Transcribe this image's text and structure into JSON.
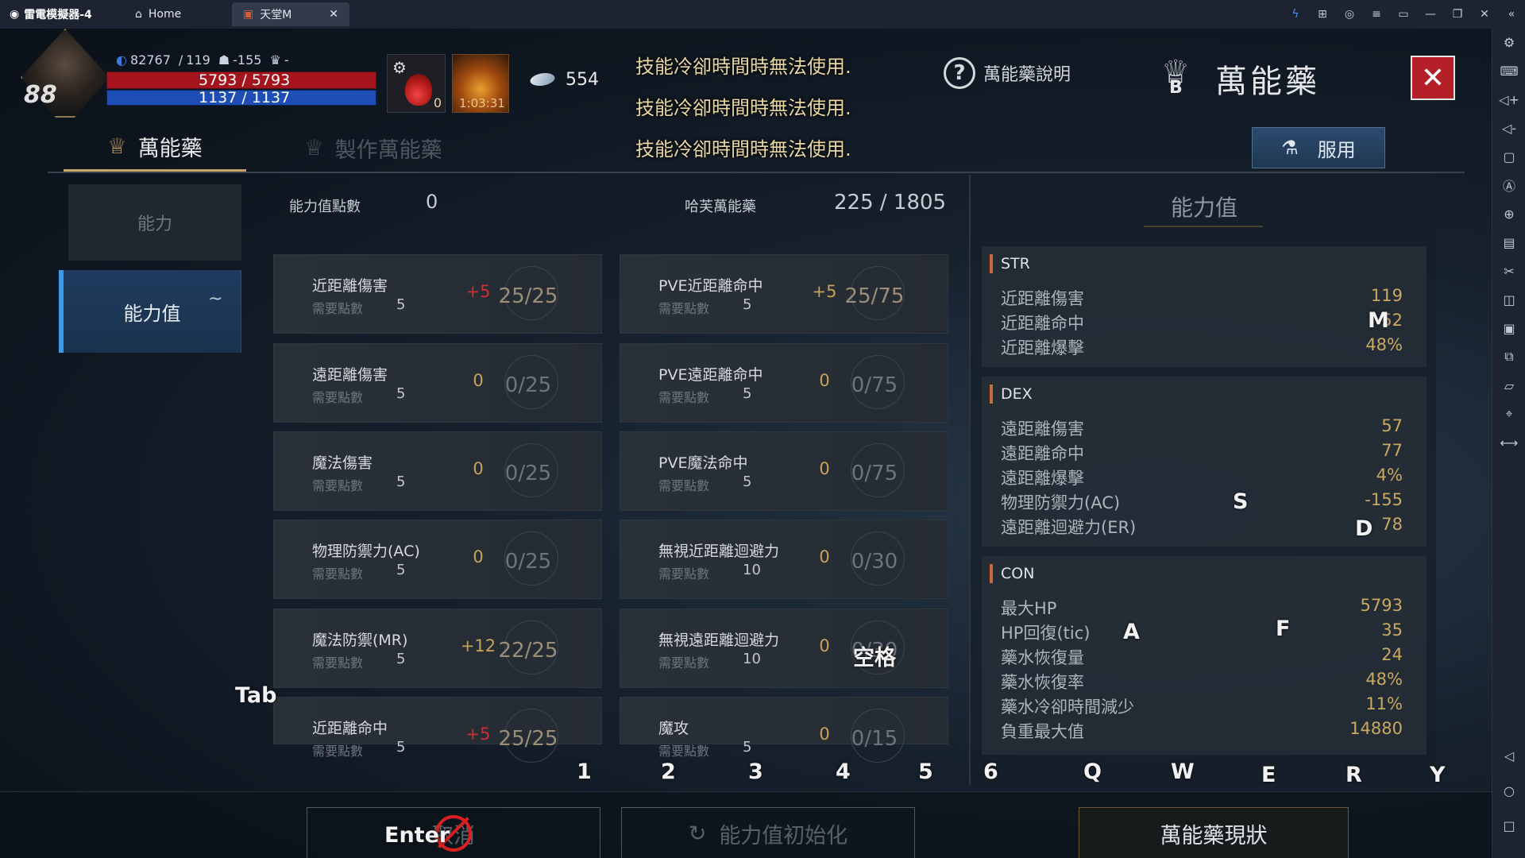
{
  "emulator": {
    "app_title": "雷電模擬器-4",
    "tabs": [
      {
        "label": "Home"
      },
      {
        "label": "天堂M"
      }
    ]
  },
  "hud": {
    "level": "88",
    "stat_a": "82767",
    "stat_b": "119",
    "stat_c": "-155",
    "stat_d": "-",
    "hp": "5793 / 5793",
    "mp": "1137 / 1137",
    "potion_count": "0",
    "buff_count": "1:03:31",
    "currency": "554",
    "cooldown_messages": [
      "技能冷卻時間時無法使用.",
      "技能冷卻時間時無法使用.",
      "技能冷卻時間時無法使用."
    ],
    "help_label": "萬能藥說明",
    "title": "萬能藥",
    "title_badge": "B"
  },
  "tabs": {
    "potion": "萬能藥",
    "craft": "製作萬能藥",
    "use_button": "服用"
  },
  "nav": {
    "ability": "能力",
    "stats": "能力值",
    "stats_badge": "~"
  },
  "counts": {
    "points_label": "能力值點數",
    "points_value": "0",
    "potion_label": "哈芙萬能藥",
    "potion_value": "225 / 1805"
  },
  "cost_label": "需要點數",
  "cards": [
    {
      "name": "近距離傷害",
      "bonus": "+5",
      "progress": "25/25",
      "cost": "5",
      "style": "red",
      "full": true
    },
    {
      "name": "PVE近距離命中",
      "bonus": "+5",
      "progress": "25/75",
      "cost": "5",
      "style": "gold",
      "full": true
    },
    {
      "name": "遠距離傷害",
      "bonus": "0",
      "progress": "0/25",
      "cost": "5",
      "style": "grey",
      "full": false
    },
    {
      "name": "PVE遠距離命中",
      "bonus": "0",
      "progress": "0/75",
      "cost": "5",
      "style": "grey",
      "full": false
    },
    {
      "name": "魔法傷害",
      "bonus": "0",
      "progress": "0/25",
      "cost": "5",
      "style": "grey",
      "full": false
    },
    {
      "name": "PVE魔法命中",
      "bonus": "0",
      "progress": "0/75",
      "cost": "5",
      "style": "grey",
      "full": false
    },
    {
      "name": "物理防禦力(AC)",
      "bonus": "0",
      "progress": "0/25",
      "cost": "5",
      "style": "grey",
      "full": false
    },
    {
      "name": "無視近距離迴避力",
      "bonus": "0",
      "progress": "0/30",
      "cost": "10",
      "style": "grey",
      "full": false
    },
    {
      "name": "魔法防禦(MR)",
      "bonus": "+12",
      "progress": "22/25",
      "cost": "5",
      "style": "gold",
      "full": true
    },
    {
      "name": "無視遠距離迴避力",
      "bonus": "0",
      "progress": "0/30",
      "cost": "10",
      "style": "grey",
      "full": false
    },
    {
      "name": "近距離命中",
      "bonus": "+5",
      "progress": "25/25",
      "cost": "5",
      "style": "red",
      "full": true
    },
    {
      "name": "魔攻",
      "bonus": "0",
      "progress": "0/15",
      "cost": "5",
      "style": "grey",
      "full": false
    }
  ],
  "stat_panel": {
    "title": "能力值",
    "groups": [
      {
        "head": "STR",
        "rows": [
          {
            "k": "近距離傷害",
            "v": "119"
          },
          {
            "k": "近距離命中",
            "v": "52"
          },
          {
            "k": "近距離爆擊",
            "v": "48%"
          }
        ]
      },
      {
        "head": "DEX",
        "rows": [
          {
            "k": "遠距離傷害",
            "v": "57"
          },
          {
            "k": "遠距離命中",
            "v": "77"
          },
          {
            "k": "遠距離爆擊",
            "v": "4%"
          },
          {
            "k": "物理防禦力(AC)",
            "v": "-155"
          },
          {
            "k": "遠距離迴避力(ER)",
            "v": "78"
          }
        ]
      },
      {
        "head": "CON",
        "rows": [
          {
            "k": "最大HP",
            "v": "5793"
          },
          {
            "k": "HP回復(tic)",
            "v": "35"
          },
          {
            "k": "藥水恢復量",
            "v": "24"
          },
          {
            "k": "藥水恢復率",
            "v": "48%"
          },
          {
            "k": "藥水冷卻時間減少",
            "v": "11%"
          },
          {
            "k": "負重最大值",
            "v": "14880"
          }
        ]
      }
    ]
  },
  "bottom": {
    "cancel": "取消",
    "reset": "能力值初始化",
    "status": "萬能藥現狀"
  },
  "keys": {
    "tab": "Tab",
    "enter": "Enter",
    "space": "空格",
    "n1": "1",
    "n2": "2",
    "n3": "3",
    "n4": "4",
    "n5": "5",
    "n6": "6",
    "q": "Q",
    "w": "W",
    "e": "E",
    "r": "R",
    "y": "Y",
    "m": "M",
    "s": "S",
    "d": "D",
    "a": "A",
    "f": "F"
  }
}
